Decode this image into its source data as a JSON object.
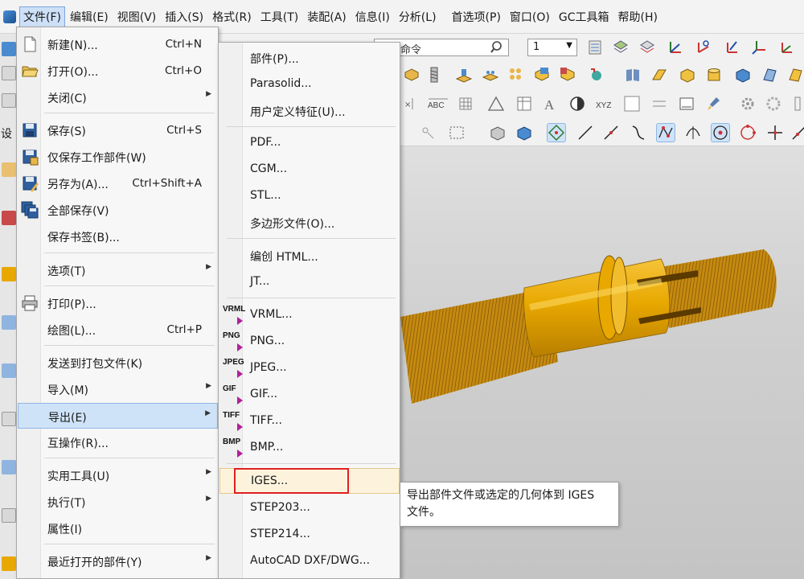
{
  "menubar": {
    "items": [
      {
        "label": "文件(F)"
      },
      {
        "label": "编辑(E)"
      },
      {
        "label": "视图(V)"
      },
      {
        "label": "插入(S)"
      },
      {
        "label": "格式(R)"
      },
      {
        "label": "工具(T)"
      },
      {
        "label": "装配(A)"
      },
      {
        "label": "信息(I)"
      },
      {
        "label": "分析(L)"
      },
      {
        "label": "首选项(P)"
      },
      {
        "label": "窗口(O)"
      },
      {
        "label": "GC工具箱"
      },
      {
        "label": "帮助(H)"
      }
    ]
  },
  "toolbar": {
    "command_search_value": "查找命令",
    "selection_filter_value": "1"
  },
  "left_strip_label": "设",
  "file_menu": {
    "items": [
      {
        "label": "新建(N)...",
        "shortcut": "Ctrl+N",
        "icon": "new-file-icon"
      },
      {
        "label": "打开(O)...",
        "shortcut": "Ctrl+O",
        "icon": "open-folder-icon"
      },
      {
        "label": "关闭(C)",
        "shortcut": "",
        "icon": "",
        "submenu": true
      },
      {
        "label": "保存(S)",
        "shortcut": "Ctrl+S",
        "icon": "save-icon"
      },
      {
        "label": "仅保存工作部件(W)",
        "shortcut": "",
        "icon": "save-work-part-icon"
      },
      {
        "label": "另存为(A)...",
        "shortcut": "Ctrl+Shift+A",
        "icon": "save-as-icon"
      },
      {
        "label": "全部保存(V)",
        "shortcut": "",
        "icon": "save-all-icon"
      },
      {
        "label": "保存书签(B)...",
        "shortcut": "",
        "icon": ""
      },
      {
        "label": "选项(T)",
        "shortcut": "",
        "icon": "",
        "submenu": true
      },
      {
        "label": "打印(P)...",
        "shortcut": "",
        "icon": "printer-icon"
      },
      {
        "label": "绘图(L)...",
        "shortcut": "Ctrl+P",
        "icon": ""
      },
      {
        "label": "发送到打包文件(K)",
        "shortcut": "",
        "icon": ""
      },
      {
        "label": "导入(M)",
        "shortcut": "",
        "icon": "",
        "submenu": true
      },
      {
        "label": "导出(E)",
        "shortcut": "",
        "icon": "",
        "submenu": true
      },
      {
        "label": "互操作(R)...",
        "shortcut": "",
        "icon": ""
      },
      {
        "label": "实用工具(U)",
        "shortcut": "",
        "icon": "",
        "submenu": true
      },
      {
        "label": "执行(T)",
        "shortcut": "",
        "icon": "",
        "submenu": true
      },
      {
        "label": "属性(I)",
        "shortcut": "",
        "icon": ""
      },
      {
        "label": "最近打开的部件(Y)",
        "shortcut": "",
        "icon": "",
        "submenu": true
      }
    ]
  },
  "export_menu": {
    "items": [
      {
        "label": "部件(P)...",
        "format": ""
      },
      {
        "label": "Parasolid...",
        "format": ""
      },
      {
        "label": "用户定义特征(U)...",
        "format": ""
      },
      {
        "label": "PDF...",
        "format": ""
      },
      {
        "label": "CGM...",
        "format": ""
      },
      {
        "label": "STL...",
        "format": ""
      },
      {
        "label": "多边形文件(O)...",
        "format": ""
      },
      {
        "label": "编创 HTML...",
        "format": ""
      },
      {
        "label": "JT...",
        "format": ""
      },
      {
        "label": "VRML...",
        "format": "VRML"
      },
      {
        "label": "PNG...",
        "format": "PNG"
      },
      {
        "label": "JPEG...",
        "format": "JPEG"
      },
      {
        "label": "GIF...",
        "format": "GIF"
      },
      {
        "label": "TIFF...",
        "format": "TIFF"
      },
      {
        "label": "BMP...",
        "format": "BMP"
      },
      {
        "label": "IGES...",
        "format": ""
      },
      {
        "label": "STEP203...",
        "format": ""
      },
      {
        "label": "STEP214...",
        "format": ""
      },
      {
        "label": "AutoCAD DXF/DWG...",
        "format": ""
      }
    ]
  },
  "tooltip": {
    "line1": "导出部件文件或选定的几何体到 IGES",
    "line2": "文件。"
  },
  "colors": {
    "highlight_file": "#cfe3f8",
    "highlight_export": "#fdf3dd",
    "annotation_box": "#e02020",
    "part_gold": "#e8a800"
  }
}
